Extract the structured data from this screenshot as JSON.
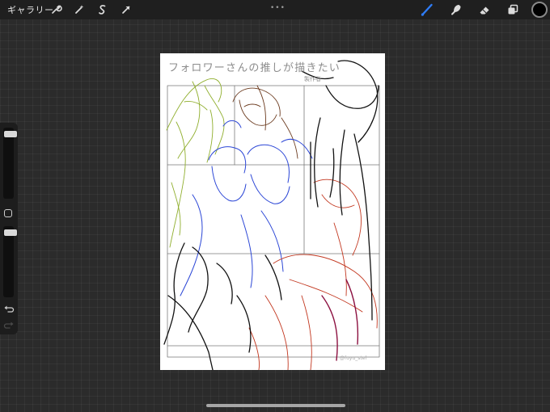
{
  "topbar": {
    "gallery_label": "ギャラリー",
    "left_tools": [
      {
        "name": "wrench-icon",
        "label": "Actions"
      },
      {
        "name": "magic-wand-icon",
        "label": "Adjustments"
      },
      {
        "name": "selection-icon",
        "label": "Selection"
      },
      {
        "name": "transform-arrow-icon",
        "label": "Transform"
      }
    ],
    "right_tools": [
      {
        "name": "brush-icon",
        "label": "Paint",
        "active": true
      },
      {
        "name": "smudge-icon",
        "label": "Smudge"
      },
      {
        "name": "eraser-icon",
        "label": "Erase"
      },
      {
        "name": "layers-icon",
        "label": "Layers"
      }
    ],
    "active_color": "#000000",
    "accent": "#2e7cf6"
  },
  "sidebar": {
    "brush_size_fraction": 0.95,
    "opacity_fraction": 0.95,
    "icons": [
      "modify-square-icon",
      "undo-icon",
      "redo-icon"
    ]
  },
  "canvas": {
    "title": "フォロワーさんの推しが描きたい",
    "subtitle": "製作者",
    "credit": "@fuyu_stel",
    "stroke_colors": {
      "green": "#8fae2c",
      "blue": "#2b46d6",
      "red": "#c2361e",
      "crimson": "#8c1040",
      "black": "#111111",
      "brown": "#6b3a1e",
      "panel": "#7a7a7a"
    }
  }
}
